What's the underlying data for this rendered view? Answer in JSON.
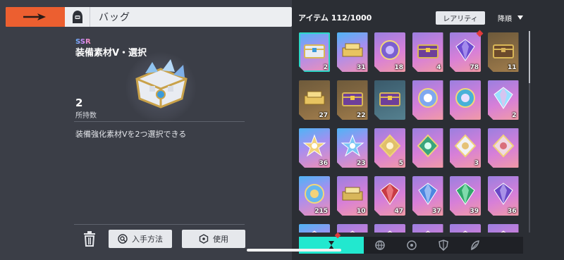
{
  "header": {
    "title": "バッグ"
  },
  "detail": {
    "rarity": "SSR",
    "name": "装備素材Ⅴ・選択",
    "owned_count": "2",
    "owned_label": "所持数",
    "description": "装備強化素材Ⅴを2つ選択できる",
    "buttons": {
      "acquire": "入手方法",
      "use": "使用"
    }
  },
  "inventory": {
    "count_label": "アイテム 112/1000",
    "rarity_button": "レアリティ",
    "sort_label": "降順",
    "items": [
      {
        "qty": "2",
        "rarity": "ssr",
        "icon": "equipment-chest-icon",
        "selected": true
      },
      {
        "qty": "31",
        "rarity": "ssr",
        "icon": "gold-bars-icon"
      },
      {
        "qty": "18",
        "rarity": "sr",
        "icon": "purple-orb-icon"
      },
      {
        "qty": "4",
        "rarity": "sr",
        "icon": "jewel-chest-icon"
      },
      {
        "qty": "78",
        "rarity": "sr",
        "icon": "purple-crystal-icon"
      },
      {
        "qty": "11",
        "rarity": "r",
        "icon": "treasure-chest-icon"
      },
      {
        "qty": "27",
        "rarity": "r",
        "icon": "gold-bars-icon"
      },
      {
        "qty": "22",
        "rarity": "r",
        "icon": "jewel-chest-icon"
      },
      {
        "qty": "",
        "rarity": "n",
        "icon": "jewel-chest-icon"
      },
      {
        "qty": "",
        "rarity": "sr",
        "icon": "cross-orb-icon"
      },
      {
        "qty": "",
        "rarity": "sr",
        "icon": "rune-orb-icon"
      },
      {
        "qty": "2",
        "rarity": "sr",
        "icon": "rainbow-crystal-icon"
      },
      {
        "qty": "36",
        "rarity": "ssr",
        "icon": "winged-star-icon"
      },
      {
        "qty": "23",
        "rarity": "ssr",
        "icon": "blue-star-icon"
      },
      {
        "qty": "5",
        "rarity": "sr",
        "icon": "gold-emblem-icon"
      },
      {
        "qty": "",
        "rarity": "sr",
        "icon": "green-emblem-icon"
      },
      {
        "qty": "3",
        "rarity": "sr",
        "icon": "white-emblem-icon"
      },
      {
        "qty": "",
        "rarity": "sr",
        "icon": "cross-emblem-icon"
      },
      {
        "qty": "215",
        "rarity": "ssr",
        "icon": "staff-key-icon"
      },
      {
        "qty": "10",
        "rarity": "sr",
        "icon": "gold-cube-icon"
      },
      {
        "qty": "47",
        "rarity": "sr",
        "icon": "red-crystal-icon"
      },
      {
        "qty": "37",
        "rarity": "sr",
        "icon": "blue-crystal-icon"
      },
      {
        "qty": "39",
        "rarity": "sr",
        "icon": "green-crystal-icon"
      },
      {
        "qty": "36",
        "rarity": "sr",
        "icon": "violet-crystal-icon"
      },
      {
        "qty": "",
        "rarity": "ssr",
        "icon": "partial-item-icon"
      },
      {
        "qty": "",
        "rarity": "sr",
        "icon": "partial-item-icon"
      },
      {
        "qty": "",
        "rarity": "sr",
        "icon": "partial-item-icon"
      },
      {
        "qty": "",
        "rarity": "sr",
        "icon": "partial-item-icon"
      },
      {
        "qty": "",
        "rarity": "sr",
        "icon": "partial-item-icon"
      },
      {
        "qty": "",
        "rarity": "sr",
        "icon": "partial-item-icon"
      }
    ],
    "filters": [
      {
        "icon": "hourglass-icon",
        "active": true
      },
      {
        "icon": "globe-icon"
      },
      {
        "icon": "target-icon"
      },
      {
        "icon": "shield-icon"
      },
      {
        "icon": "feather-icon"
      }
    ]
  },
  "colors": {
    "accent": "#ec5f30",
    "selected": "#2dd7c8",
    "filter_active": "#22e8cf",
    "alert": "#e23b3b"
  }
}
